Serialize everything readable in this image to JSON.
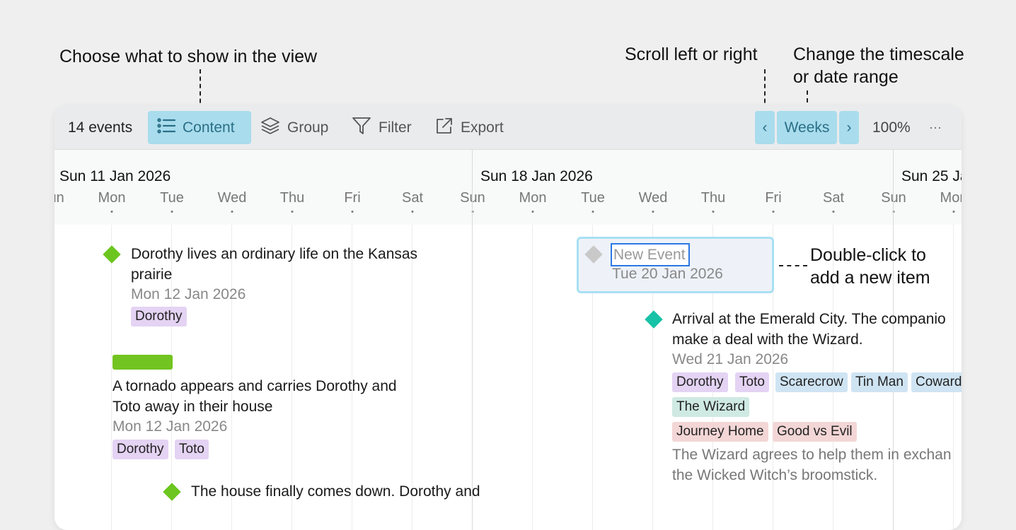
{
  "callouts": {
    "content": "Choose what to show in the view",
    "scroll": "Scroll left or right",
    "timescale_1": "Change the timescale",
    "timescale_2": "or date range",
    "dblclick_1": "Double-click to",
    "dblclick_2": "add a new item"
  },
  "toolbar": {
    "event_count": "14 events",
    "content_label": "Content",
    "group_label": "Group",
    "filter_label": "Filter",
    "export_label": "Export",
    "prev_glyph": "‹",
    "timescale_label": "Weeks",
    "next_glyph": "›",
    "zoom_label": "100%",
    "more_glyph": "···"
  },
  "timeline": {
    "weeks": [
      "Sun 11 Jan 2026",
      "Sun 18 Jan 2026",
      "Sun 25 Ja"
    ],
    "days": [
      "Sun",
      "Mon",
      "Tue",
      "Wed",
      "Thu",
      "Fri",
      "Sat",
      "Sun",
      "Mon",
      "Tue",
      "Wed",
      "Thu",
      "Fri",
      "Sat",
      "Sun",
      "Mon"
    ]
  },
  "events": [
    {
      "title_lines": [
        "Dorothy lives an ordinary life on the Kansas",
        "prairie"
      ],
      "date": "Mon 12 Jan 2026",
      "tags": [
        "Dorothy"
      ],
      "marker": "diamond",
      "color": "#6cc61f"
    },
    {
      "title_lines": [
        "A tornado appears and carries Dorothy and",
        "Toto away in their house"
      ],
      "date": "Mon 12 Jan 2026",
      "tags": [
        "Dorothy",
        "Toto"
      ],
      "marker": "bar",
      "color": "#72c420"
    },
    {
      "title_lines": [
        "New Event"
      ],
      "date": "Tue 20 Jan 2026",
      "marker": "diamond",
      "color": "#c9c9c9"
    },
    {
      "title_lines": [
        "Arrival at the Emerald City. The companio",
        "make a deal with the Wizard."
      ],
      "date": "Wed 21 Jan 2026",
      "tags": [
        "Dorothy",
        "Toto",
        "Scarecrow",
        "Tin Man",
        "Coward",
        "The Wizard",
        "Journey Home",
        "Good vs Evil"
      ],
      "description_lines": [
        "The Wizard agrees to help them in exchan",
        "the Wicked Witch’s broomstick."
      ],
      "marker": "diamond",
      "color": "#17c2a6"
    },
    {
      "title_lines": [
        "The house finally comes down. Dorothy and"
      ],
      "marker": "diamond",
      "color": "#6cc61f"
    }
  ],
  "colors": {
    "accent_button_bg": "#a9dcec",
    "accent_button_text": "#2a6f88",
    "selection_border": "#2b78e4"
  }
}
